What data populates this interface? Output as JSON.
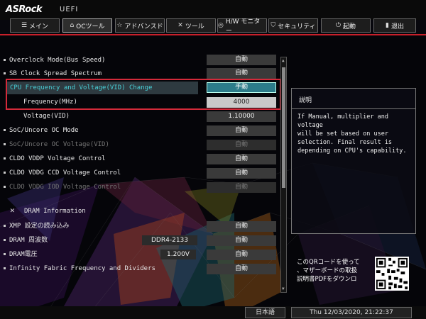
{
  "app": {
    "brand": "ASRock",
    "mode": "UEFI"
  },
  "tabs": [
    {
      "icon": "main-icon",
      "label": "メイン"
    },
    {
      "icon": "oc-tweaker-icon",
      "label": "OCツール"
    },
    {
      "icon": "star-icon",
      "label": "アドバンスド"
    },
    {
      "icon": "tool-icon",
      "label": "ツール"
    },
    {
      "icon": "hw-monitor-icon",
      "label": "H/W モニター"
    },
    {
      "icon": "shield-icon",
      "label": "セキュリティ"
    },
    {
      "icon": "power-icon",
      "label": "起動"
    },
    {
      "icon": "exit-icon",
      "label": "退出"
    }
  ],
  "active_tab": "OCツール",
  "settings": [
    {
      "label": "Overclock Mode(Bus Speed)",
      "value": "自動"
    },
    {
      "label": "SB Clock Spread Spectrum",
      "value": "自動"
    },
    {
      "label": "CPU Frequency and Voltage(VID) Change",
      "value": "手動"
    },
    {
      "label": "Frequency(MHz)",
      "value": "4000"
    },
    {
      "label": "Voltage(VID)",
      "value": "1.10000"
    },
    {
      "label": "SoC/Uncore OC Mode",
      "value": "自動"
    },
    {
      "label": "SoC/Uncore OC Voltage(VID)",
      "value": "自動"
    },
    {
      "label": "CLDO VDDP Voltage Control",
      "value": "自動"
    },
    {
      "label": "CLDO VDDG CCD Voltage Control",
      "value": "自動"
    },
    {
      "label": "CLDO VDDG IOD Voltage Control",
      "value": "自動"
    },
    {
      "label": "DRAM Information"
    },
    {
      "label": "XMP 設定の読み込み",
      "value": "自動"
    },
    {
      "label": "DRAM 周波数",
      "current": "DDR4-2133",
      "value": "自動"
    },
    {
      "label": "DRAM電圧",
      "current": "1.200V",
      "value": "自動"
    },
    {
      "label": "Infinity Fabric Frequency and Dividers",
      "value": "自動"
    }
  ],
  "description": {
    "title": "説明",
    "text": "If Manual, multiplier and voltage\nwill be set based on user\nselection. Final result is\ndepending on CPU's capability."
  },
  "qr": {
    "text": "このQRコードを使って\n、マザーボードの取扱\n説明書PDFをダウンロ"
  },
  "footer": {
    "language": "日本語",
    "datetime": "Thu 12/03/2020, 21:22:37"
  },
  "colors": {
    "accent_red": "#c8202a",
    "selected_cyan": "#49d0d8"
  }
}
